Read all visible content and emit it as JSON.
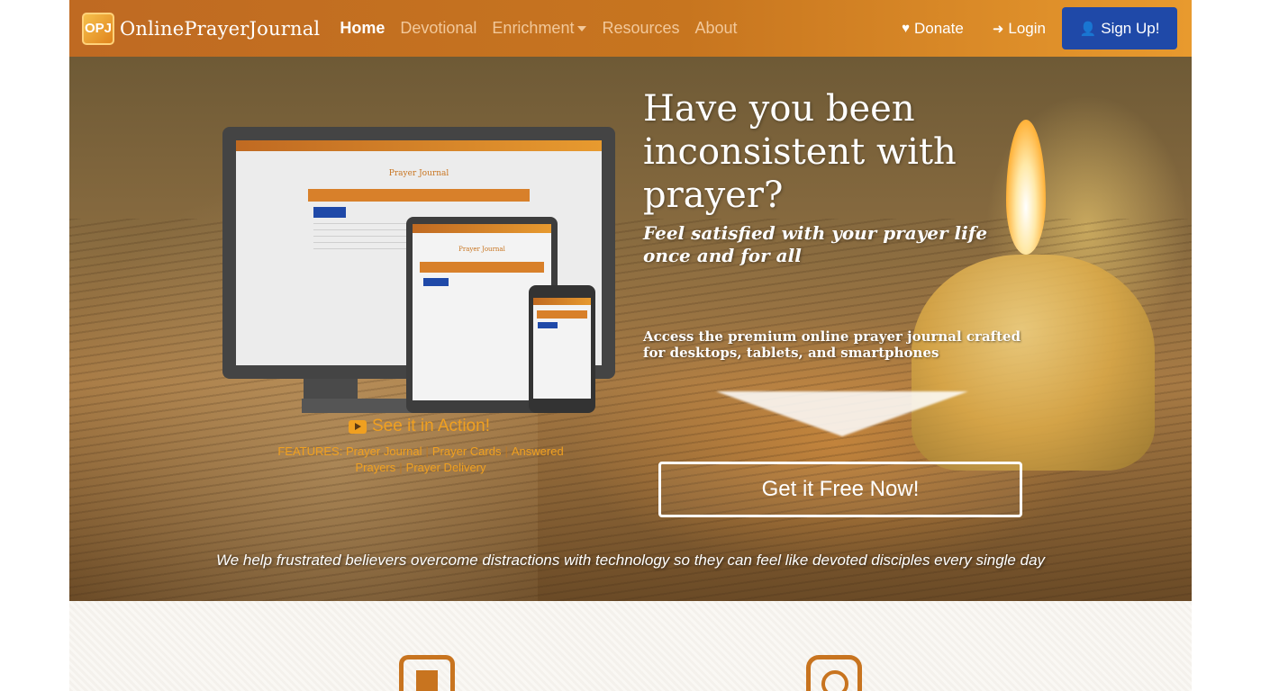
{
  "brand": {
    "logo_text": "OPJ",
    "name": "OnlinePrayerJournal"
  },
  "nav": {
    "items": [
      {
        "label": "Home",
        "active": true
      },
      {
        "label": "Devotional",
        "active": false
      },
      {
        "label": "Enrichment",
        "active": false,
        "dropdown": true
      },
      {
        "label": "Resources",
        "active": false
      },
      {
        "label": "About",
        "active": false
      }
    ],
    "donate": "Donate",
    "login": "Login",
    "signup": "Sign Up!"
  },
  "hero": {
    "headline": "Have you been inconsistent with prayer?",
    "subhead": "Feel satisfied with your prayer life once and for all",
    "access": "Access the premium online prayer journal crafted for desktops, tablets, and smartphones",
    "cta": "Get it Free Now!",
    "see_action": "See it in Action!",
    "features_prefix": "FEATURES:",
    "features": [
      "Prayer Journal",
      "Prayer Cards",
      "Answered Prayers",
      "Prayer Delivery"
    ],
    "tagline": "We help frustrated believers overcome distractions with technology so they can feel like devoted disciples every single day"
  },
  "mockup": {
    "screen_title": "Prayer Journal",
    "panel_title": "Prayer Journal"
  },
  "colors": {
    "navbar": "#c7751f",
    "accent": "#f0a020",
    "signup": "#1f49a8",
    "feature_icon": "#c8741f"
  }
}
